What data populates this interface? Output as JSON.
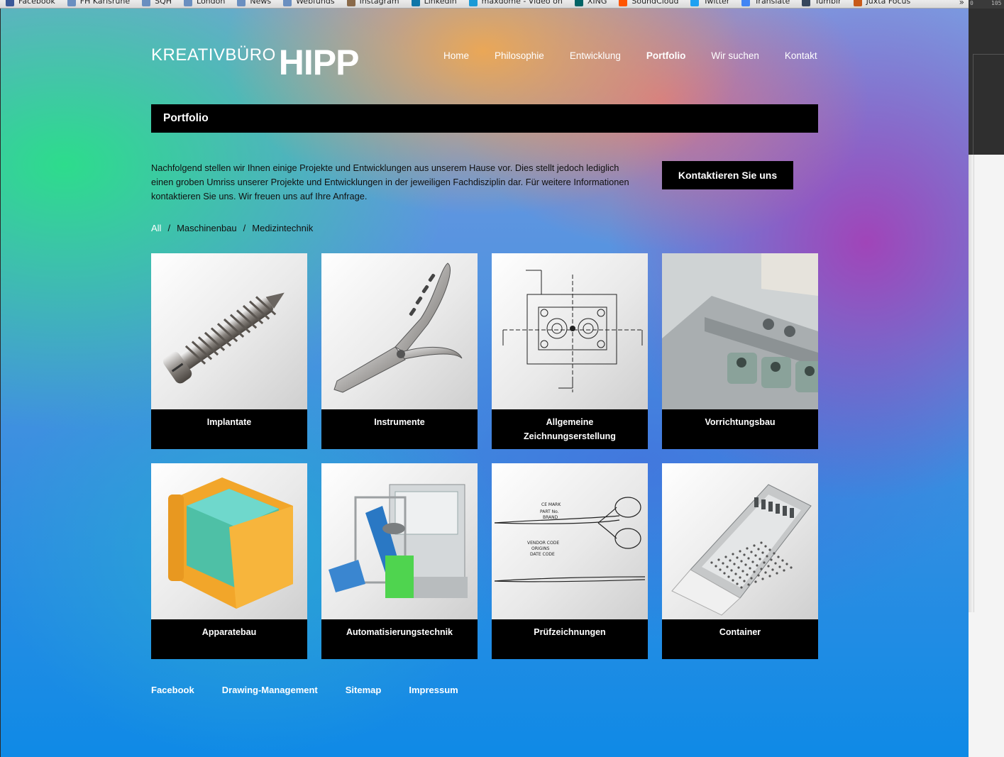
{
  "bookmarks": [
    {
      "label": "Facebook",
      "color": "#3b5998"
    },
    {
      "label": "FH Karlsruhe",
      "color": "#6a8fc0"
    },
    {
      "label": "SQH",
      "color": "#6a8fc0"
    },
    {
      "label": "London",
      "color": "#6a8fc0"
    },
    {
      "label": "News",
      "color": "#6a8fc0"
    },
    {
      "label": "Webfunds",
      "color": "#6a8fc0"
    },
    {
      "label": "Instagram",
      "color": "#8a6a4a"
    },
    {
      "label": "LinkedIn",
      "color": "#0e76a8"
    },
    {
      "label": "maxdome - Video on",
      "color": "#1a9ad6"
    },
    {
      "label": "XING",
      "color": "#026466"
    },
    {
      "label": "SoundCloud",
      "color": "#ff5500"
    },
    {
      "label": "Twitter",
      "color": "#1da1f2"
    },
    {
      "label": "Translate",
      "color": "#4285f4"
    },
    {
      "label": "Tumblr",
      "color": "#35465c"
    },
    {
      "label": "Juxta Focus",
      "color": "#c85a1a"
    }
  ],
  "bookmarks_more": "»",
  "ruler": {
    "a": "0",
    "b": "105"
  },
  "logo": {
    "light": "KREATIVBÜRO",
    "bold": "HIPP"
  },
  "nav": [
    {
      "label": "Home",
      "active": false
    },
    {
      "label": "Philosophie",
      "active": false
    },
    {
      "label": "Entwicklung",
      "active": false
    },
    {
      "label": "Portfolio",
      "active": true
    },
    {
      "label": "Wir suchen",
      "active": false
    },
    {
      "label": "Kontakt",
      "active": false
    }
  ],
  "page_title": "Portfolio",
  "intro": "Nachfolgend stellen wir Ihnen einige Projekte und Entwicklungen aus unserem Hause vor. Dies stellt jedoch lediglich einen groben Umriss unserer Projekte und Entwicklungen in der jeweiligen Fachdisziplin dar. Für weitere Informationen kontaktieren Sie uns. Wir freuen uns auf Ihre Anfrage.",
  "contact_button": "Kontaktieren Sie uns",
  "filters": [
    {
      "label": "All",
      "active": true
    },
    {
      "label": "Maschinenbau",
      "active": false
    },
    {
      "label": "Medizintechnik",
      "active": false
    }
  ],
  "filter_separator": "/",
  "portfolio": [
    {
      "label": "Implantate",
      "icon": "screw-implant-image"
    },
    {
      "label": "Instrumente",
      "icon": "pliers-instrument-image"
    },
    {
      "label": "Allgemeine Zeichnungserstellung",
      "icon": "technical-drawing-image"
    },
    {
      "label": "Vorrichtungsbau",
      "icon": "fixture-image"
    },
    {
      "label": "Apparatebau",
      "icon": "apparatus-box-image"
    },
    {
      "label": "Automatisierungstechnik",
      "icon": "automation-machine-image"
    },
    {
      "label": "Prüfzeichnungen",
      "icon": "scissors-drawing-image"
    },
    {
      "label": "Container",
      "icon": "sterile-container-image"
    }
  ],
  "footer": [
    "Facebook",
    "Drawing-Management",
    "Sitemap",
    "Impressum"
  ],
  "colors": {
    "label_bg": "#000000",
    "text_dark": "#111111",
    "text_light": "#ffffff"
  }
}
